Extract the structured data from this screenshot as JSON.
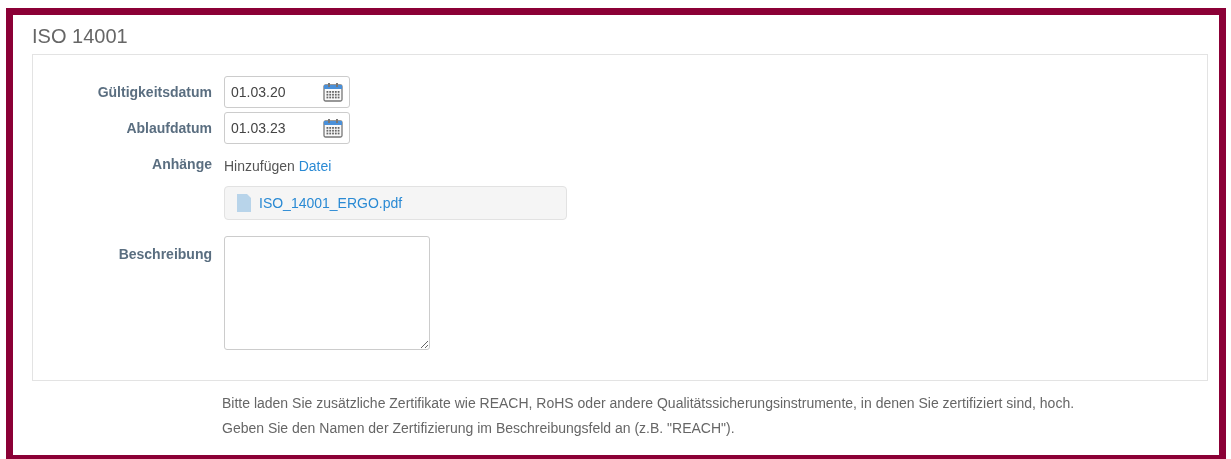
{
  "title": "ISO 14001",
  "fields": [
    {
      "kind": "date",
      "label": "Gültigkeitsdatum",
      "value": "01.03.20"
    },
    {
      "kind": "date",
      "label": "Ablaufdatum",
      "value": "01.03.23"
    },
    {
      "kind": "attachments",
      "label": "Anhänge",
      "add_text": "Hinzufügen",
      "add_link": "Datei",
      "files": [
        "ISO_14001_ERGO.pdf"
      ]
    },
    {
      "kind": "textarea",
      "label": "Beschreibung"
    }
  ],
  "hint": [
    "Bitte laden Sie zusätzliche Zertifikate wie REACH, RoHS oder andere Qualitätssicherungsinstrumente, in denen Sie zertifiziert sind, hoch.",
    "Geben Sie den Namen der Zertifizierung im Beschreibungsfeld an (z.B. \"REACH\")."
  ]
}
